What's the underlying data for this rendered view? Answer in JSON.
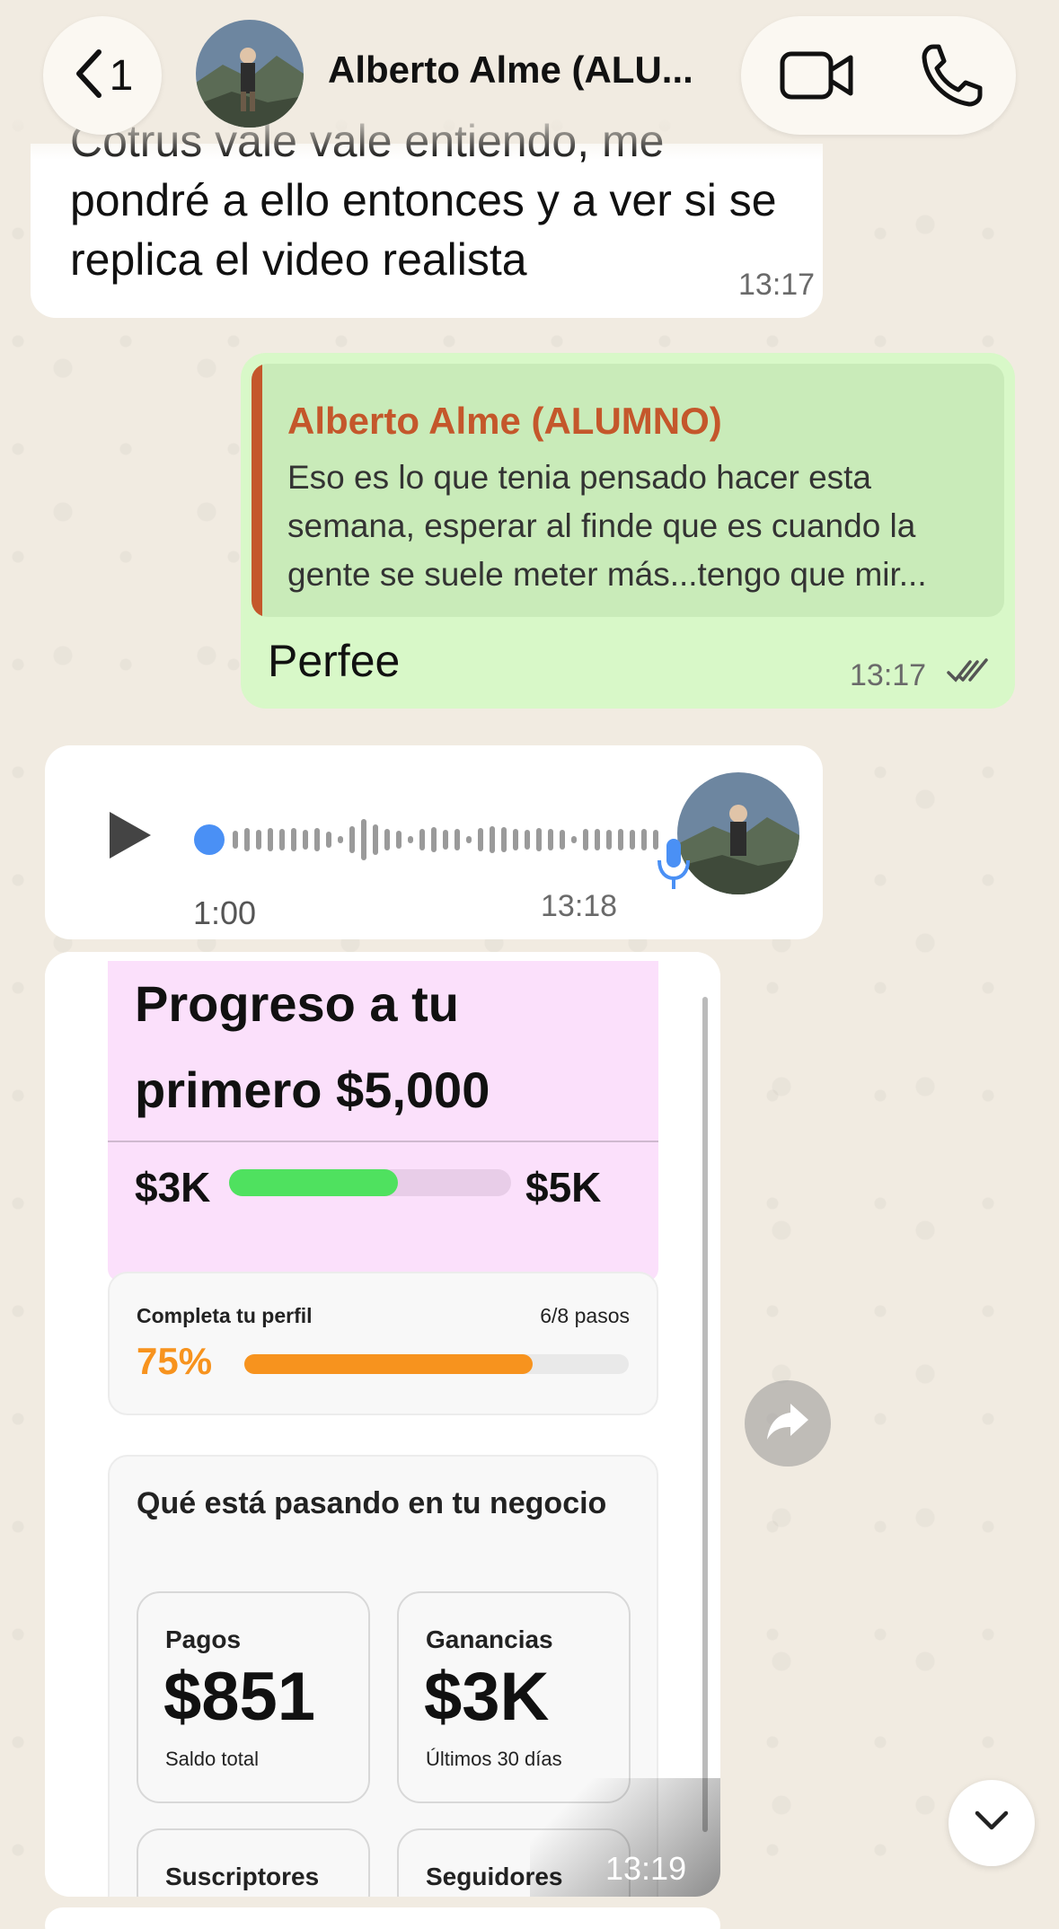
{
  "header": {
    "unread_count": "1",
    "contact_name": "Alberto Alme (ALU..."
  },
  "messages": {
    "incoming_text": {
      "text": "Cotrus vale vale entiendo, me pondré a ello entonces y a ver si se replica el video realista",
      "time": "13:17"
    },
    "outgoing_reply": {
      "quote_author": "Alberto Alme (ALUMNO)",
      "quote_text": "Eso es lo que tenia pensado hacer esta semana, esperar al finde que es cuando la gente se suele meter más...tengo que mir...",
      "text": "Perfee",
      "time": "13:17"
    },
    "voice_note": {
      "duration": "1:00",
      "time": "13:18"
    },
    "image": {
      "time": "13:19",
      "progress_card": {
        "title": "Progreso a tu primero $5,000",
        "low_label": "$3K",
        "high_label": "$5K",
        "fill_fraction": 0.6
      },
      "profile_card": {
        "label": "Completa tu perfil",
        "steps": "6/8 pasos",
        "percent": "75%",
        "fill_fraction": 0.75
      },
      "business_card": {
        "heading": "Qué está pasando en tu negocio",
        "stats": [
          {
            "label": "Pagos",
            "value": "$851",
            "sub": "Saldo total"
          },
          {
            "label": "Ganancias",
            "value": "$3K",
            "sub": "Últimos 30 días"
          },
          {
            "label": "Suscriptores"
          },
          {
            "label": "Seguidores"
          }
        ]
      }
    }
  },
  "colors": {
    "outgoing_bubble": "#d8f8c8",
    "quote_accent": "#c4572b",
    "progress_green": "#4fe15f",
    "progress_orange": "#f7931e",
    "voice_dot": "#4a90f5"
  },
  "icons": [
    "chevron-left-icon",
    "video-camera-icon",
    "phone-icon",
    "double-check-icon",
    "play-icon",
    "microphone-icon",
    "forward-icon",
    "chevron-down-icon"
  ]
}
